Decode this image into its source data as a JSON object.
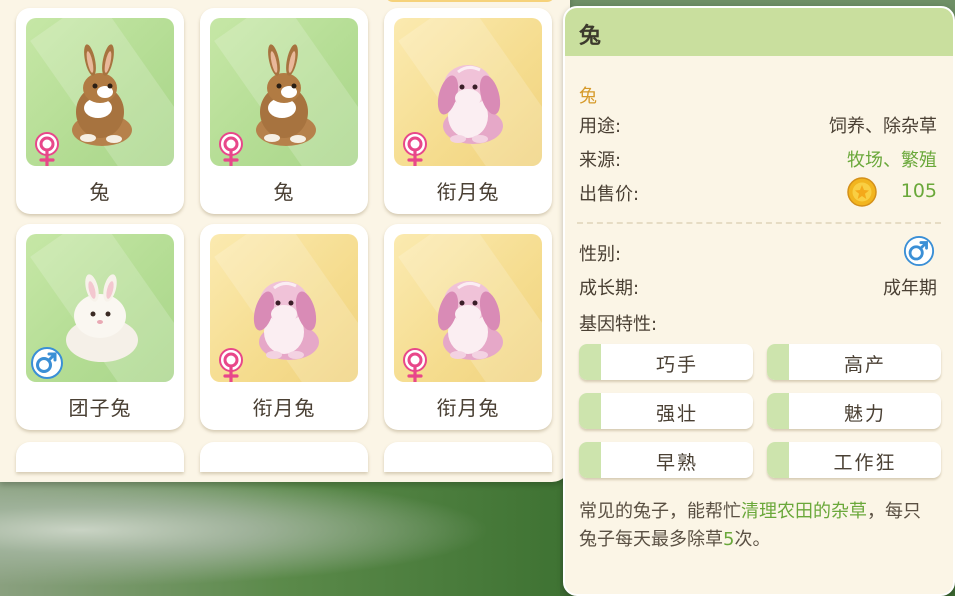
{
  "animal_grid": {
    "cards": [
      {
        "name": "兔",
        "gender_icon": "female-icon",
        "bg": "green",
        "breed": "brown"
      },
      {
        "name": "兔",
        "gender_icon": "female-icon",
        "bg": "green",
        "breed": "brown"
      },
      {
        "name": "衔月兔",
        "gender_icon": "female-icon",
        "bg": "yellow",
        "breed": "pink"
      },
      {
        "name": "团子兔",
        "gender_icon": "male-icon",
        "bg": "green",
        "breed": "white"
      },
      {
        "name": "衔月兔",
        "gender_icon": "female-icon",
        "bg": "yellow",
        "breed": "pink"
      },
      {
        "name": "衔月兔",
        "gender_icon": "female-icon",
        "bg": "yellow",
        "breed": "pink"
      }
    ]
  },
  "detail": {
    "title": "兔",
    "species": "兔",
    "use_label": "用途:",
    "use_value": "饲养、除杂草",
    "source_label": "来源:",
    "source_value": "牧场、繁殖",
    "price_label": "出售价:",
    "price_value": "105",
    "gender_label": "性别:",
    "gender_icon": "male-icon",
    "growth_label": "成长期:",
    "growth_value": "成年期",
    "genes_label": "基因特性:",
    "traits": [
      "巧手",
      "高产",
      "强壮",
      "魅力",
      "早熟",
      "工作狂"
    ],
    "desc_part1": "常见的兔子，能帮忙",
    "desc_hl1": "清理农田的杂草",
    "desc_part2": "，每只兔子每天最多除草",
    "desc_hl2": "5",
    "desc_part3": "次。"
  },
  "colors": {
    "female": "#e8478a",
    "male": "#3a8fd6",
    "accent_green": "#6aa83a",
    "species_orange": "#d69a2a"
  }
}
